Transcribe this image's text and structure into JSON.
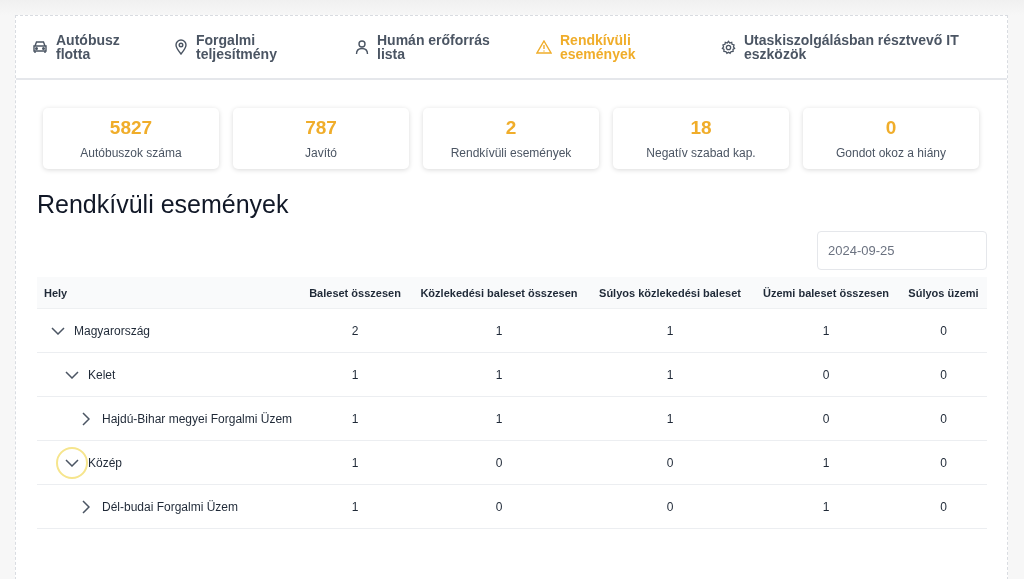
{
  "tabs": [
    {
      "label": "Autóbusz flotta",
      "selected": false
    },
    {
      "label": "Forgalmi teljesítmény",
      "selected": false
    },
    {
      "label": "Humán erőforrás lista",
      "selected": false
    },
    {
      "label": "Rendkívüli események",
      "selected": true
    },
    {
      "label": "Utaskiszolgálásban résztvevő IT eszközök",
      "selected": false
    }
  ],
  "stats": [
    {
      "value": "5827",
      "label": "Autóbuszok száma"
    },
    {
      "value": "787",
      "label": "Javító"
    },
    {
      "value": "2",
      "label": "Rendkívüli események"
    },
    {
      "value": "18",
      "label": "Negatív szabad kap."
    },
    {
      "value": "0",
      "label": "Gondot okoz a hiány"
    }
  ],
  "heading": "Rendkívüli események",
  "date_field": {
    "value": "2024-09-25"
  },
  "table": {
    "columns": [
      "Hely",
      "Baleset összesen",
      "Közlekedési baleset összesen",
      "Súlyos közlekedési baleset",
      "Üzemi baleset összesen",
      "Súlyos üzemi"
    ],
    "rows": [
      {
        "cells": [
          "Magyarország",
          "2",
          "1",
          "1",
          "1",
          "0"
        ],
        "expanded": true,
        "focused": false,
        "children": [
          {
            "cells": [
              "Kelet",
              "1",
              "1",
              "1",
              "0",
              "0"
            ],
            "expanded": true,
            "focused": false,
            "children": [
              {
                "cells": [
                  "Hajdú-Bihar megyei Forgalmi Üzem",
                  "1",
                  "1",
                  "1",
                  "0",
                  "0"
                ],
                "expanded": false,
                "focused": false
              }
            ]
          },
          {
            "cells": [
              "Közép",
              "1",
              "0",
              "0",
              "1",
              "0"
            ],
            "expanded": true,
            "focused": true,
            "children": [
              {
                "cells": [
                  "Dél-budai Forgalmi Üzem",
                  "1",
                  "0",
                  "0",
                  "1",
                  "0"
                ],
                "expanded": false,
                "focused": false
              }
            ]
          }
        ]
      }
    ]
  }
}
